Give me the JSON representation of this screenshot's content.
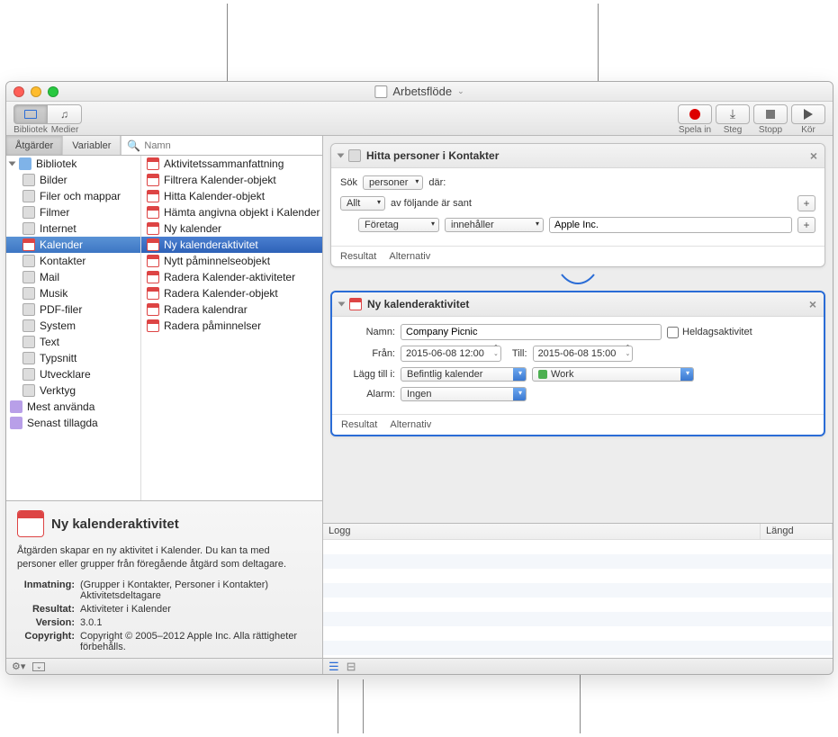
{
  "window": {
    "title": "Arbetsflöde"
  },
  "toolbar": {
    "library": "Bibliotek",
    "media": "Medier",
    "record": "Spela in",
    "step": "Steg",
    "stop": "Stopp",
    "run": "Kör"
  },
  "left_tabs": {
    "actions": "Åtgärder",
    "variables": "Variabler",
    "search_placeholder": "Namn"
  },
  "library": {
    "root": "Bibliotek",
    "categories": [
      "Bilder",
      "Filer och mappar",
      "Filmer",
      "Internet",
      "Kalender",
      "Kontakter",
      "Mail",
      "Musik",
      "PDF-filer",
      "System",
      "Text",
      "Typsnitt",
      "Utvecklare",
      "Verktyg"
    ],
    "selected_category": "Kalender",
    "smart": [
      "Mest använda",
      "Senast tillagda"
    ],
    "actions": [
      "Aktivitetssammanfattning",
      "Filtrera Kalender-objekt",
      "Hitta Kalender-objekt",
      "Hämta angivna objekt i Kalender",
      "Ny kalender",
      "Ny kalenderaktivitet",
      "Nytt påminnelseobjekt",
      "Radera Kalender-aktiviteter",
      "Radera Kalender-objekt",
      "Radera kalendrar",
      "Radera påminnelser"
    ],
    "selected_action": "Ny kalenderaktivitet"
  },
  "info": {
    "title": "Ny kalenderaktivitet",
    "desc": "Åtgärden skapar en ny aktivitet i Kalender. Du kan ta med personer eller grupper från föregående åtgärd som deltagare.",
    "rows": {
      "input_label": "Inmatning:",
      "input_value": "(Grupper i Kontakter, Personer i Kontakter) Aktivitetsdeltagare",
      "result_label": "Resultat:",
      "result_value": "Aktiviteter i Kalender",
      "version_label": "Version:",
      "version_value": "3.0.1",
      "copyright_label": "Copyright:",
      "copyright_value": "Copyright © 2005–2012 Apple Inc. Alla rättigheter förbehålls."
    }
  },
  "action1": {
    "title": "Hitta personer i Kontakter",
    "search_label": "Sök",
    "scope": "personer",
    "where": "där:",
    "all": "Allt",
    "of_following": "av följande är sant",
    "field": "Företag",
    "op": "innehåller",
    "value": "Apple Inc.",
    "result": "Resultat",
    "options": "Alternativ"
  },
  "action2": {
    "title": "Ny kalenderaktivitet",
    "name_label": "Namn:",
    "name_value": "Company Picnic",
    "allday": "Heldagsaktivitet",
    "from_label": "Från:",
    "from_value": "2015-06-08 12:00",
    "to_label": "Till:",
    "to_value": "2015-06-08 15:00",
    "addto_label": "Lägg till i:",
    "addto_value": "Befintlig kalender",
    "calendar": "Work",
    "alarm_label": "Alarm:",
    "alarm_value": "Ingen",
    "result": "Resultat",
    "options": "Alternativ"
  },
  "log": {
    "col1": "Logg",
    "col2": "Längd"
  }
}
